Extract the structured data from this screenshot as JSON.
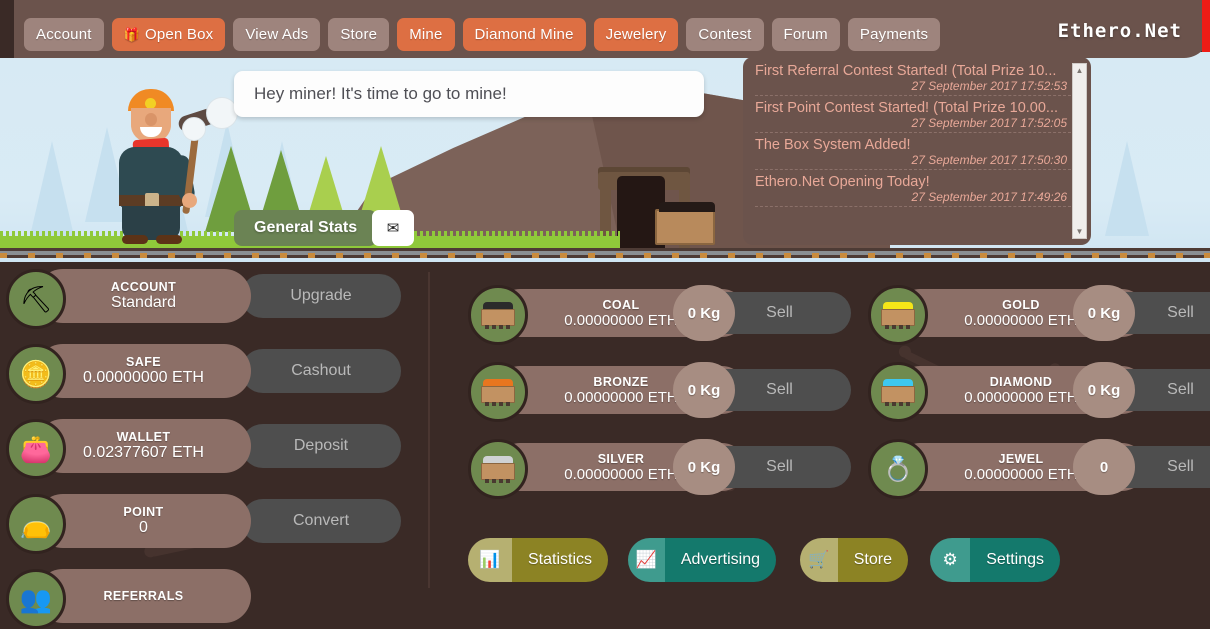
{
  "brand": "Ethero.Net",
  "nav": {
    "items": [
      {
        "label": "Account",
        "style": "neutral",
        "icon": ""
      },
      {
        "label": "Open Box",
        "style": "accent",
        "icon": "gift-icon"
      },
      {
        "label": "View Ads",
        "style": "neutral",
        "icon": ""
      },
      {
        "label": "Store",
        "style": "neutral",
        "icon": ""
      },
      {
        "label": "Mine",
        "style": "accent",
        "icon": ""
      },
      {
        "label": "Diamond Mine",
        "style": "accent",
        "icon": ""
      },
      {
        "label": "Jewelery",
        "style": "accent",
        "icon": ""
      },
      {
        "label": "Contest",
        "style": "neutral",
        "icon": ""
      },
      {
        "label": "Forum",
        "style": "neutral",
        "icon": ""
      },
      {
        "label": "Payments",
        "style": "neutral",
        "icon": ""
      }
    ]
  },
  "hero": {
    "bubble_text": "Hey miner! It's time to go to mine!",
    "general_stats_label": "General Stats",
    "mail_icon": "envelope-icon"
  },
  "news": {
    "items": [
      {
        "title": "First Referral Contest Started! (Total Prize 10...",
        "date": "27 September 2017 17:52:53"
      },
      {
        "title": "First Point Contest Started! (Total Prize 10.00...",
        "date": "27 September 2017 17:52:05"
      },
      {
        "title": "The Box System Added!",
        "date": "27 September 2017 17:50:30"
      },
      {
        "title": "Ethero.Net Opening Today!",
        "date": "27 September 2017 17:49:26"
      }
    ]
  },
  "sidebar": {
    "rows": [
      {
        "label": "ACCOUNT",
        "value": "Standard",
        "action": "Upgrade",
        "icon": "pickaxe-icon"
      },
      {
        "label": "SAFE",
        "value": "0.00000000 ETH",
        "action": "Cashout",
        "icon": "gold-coins-icon"
      },
      {
        "label": "WALLET",
        "value": "0.02377607 ETH",
        "action": "Deposit",
        "icon": "wallet-icon"
      },
      {
        "label": "POINT",
        "value": "0",
        "action": "Convert",
        "icon": "purse-icon"
      },
      {
        "label": "REFERRALS",
        "value": "",
        "action": "",
        "icon": "referrals-icon"
      }
    ]
  },
  "resources": {
    "sell_label": "Sell",
    "left": [
      {
        "name": "COAL",
        "amount": "0.00000000 ETH",
        "qty": "0 Kg",
        "color": "#2b2b2b",
        "icon": "coal-cart-icon"
      },
      {
        "name": "BRONZE",
        "amount": "0.00000000 ETH",
        "qty": "0 Kg",
        "color": "#e8761f",
        "icon": "bronze-cart-icon"
      },
      {
        "name": "SILVER",
        "amount": "0.00000000 ETH",
        "qty": "0 Kg",
        "color": "#cfd2d4",
        "icon": "silver-cart-icon"
      }
    ],
    "right": [
      {
        "name": "GOLD",
        "amount": "0.00000000 ETH",
        "qty": "0 Kg",
        "color": "#f5e618",
        "icon": "gold-cart-icon"
      },
      {
        "name": "DIAMOND",
        "amount": "0.00000000 ETH",
        "qty": "0 Kg",
        "color": "#3ec8f0",
        "icon": "diamond-cart-icon"
      },
      {
        "name": "JEWEL",
        "amount": "0.00000000 ETH",
        "qty": "0",
        "color": "#e0317a",
        "icon": "jewel-icon"
      }
    ]
  },
  "actions": [
    {
      "label": "Statistics",
      "style": "olive",
      "icon": "chart-bar-icon"
    },
    {
      "label": "Advertising",
      "style": "teal",
      "icon": "chart-line-icon"
    },
    {
      "label": "Store",
      "style": "olive",
      "icon": "cart-icon"
    },
    {
      "label": "Settings",
      "style": "teal",
      "icon": "gear-icon"
    }
  ],
  "colors": {
    "nav_accent": "#dd6f43",
    "nav_neutral": "#9e847d",
    "panel": "#6b534c",
    "background": "#3a2a26",
    "pill": "#8c6f67",
    "olive": "#8c8324",
    "teal": "#14796c",
    "red_strip": "#ee1c16"
  }
}
